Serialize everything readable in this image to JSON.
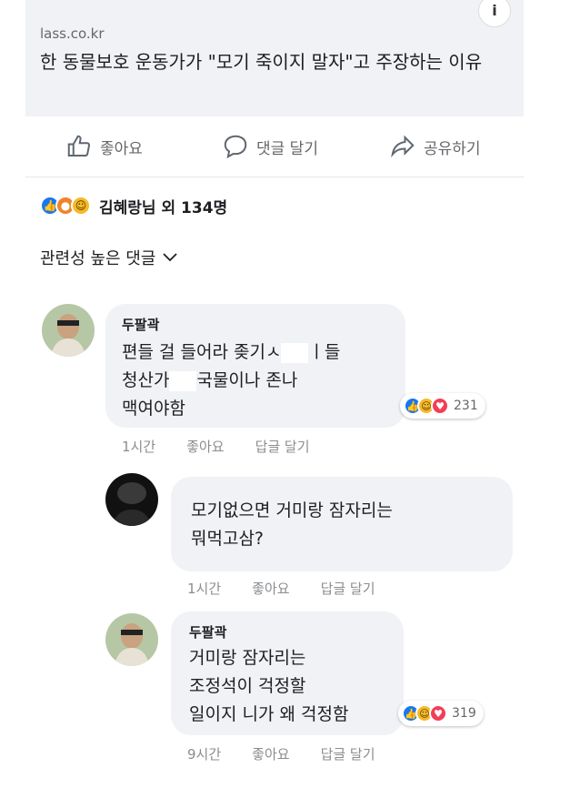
{
  "link_preview": {
    "domain": "lass.co.kr",
    "title": "한 동물보호 운동가가 \"모기 죽이지 말자\"고 주장하는 이유",
    "info_glyph": "i"
  },
  "actions": {
    "like": "좋아요",
    "comment": "댓글 달기",
    "share": "공유하기"
  },
  "reactions_summary": {
    "text": "김혜랑님 외 134명",
    "icons": [
      "like",
      "angry",
      "haha"
    ]
  },
  "sort_label": "관련성 높은 댓글",
  "comments": [
    {
      "author": "두팔곽",
      "lines": [
        "편들 걸 들어라 좆기ㅅ",
        "ㅣ들",
        "청산가",
        "국물이나 존나",
        "맥여야함"
      ],
      "reaction_count": "231",
      "time": "1시간",
      "like_label": "좋아요",
      "reply_label": "답글 달기"
    },
    {
      "author": "",
      "lines": [
        "모기없으면 거미랑 잠자리는",
        "뭐먹고삼?"
      ],
      "time": "1시간",
      "like_label": "좋아요",
      "reply_label": "답글 달기"
    },
    {
      "author": "두팔곽",
      "lines": [
        "거미랑 잠자리는",
        "조정석이 걱정할",
        "일이지 니가 왜 걱정함"
      ],
      "reaction_count": "319",
      "time": "9시간",
      "like_label": "좋아요",
      "reply_label": "답글 달기"
    }
  ],
  "colors": {
    "like": "#1877f2",
    "love": "#f33e58",
    "haha": "#f7b928",
    "angry": "#f0832a",
    "bubble": "#f0f2f5"
  }
}
